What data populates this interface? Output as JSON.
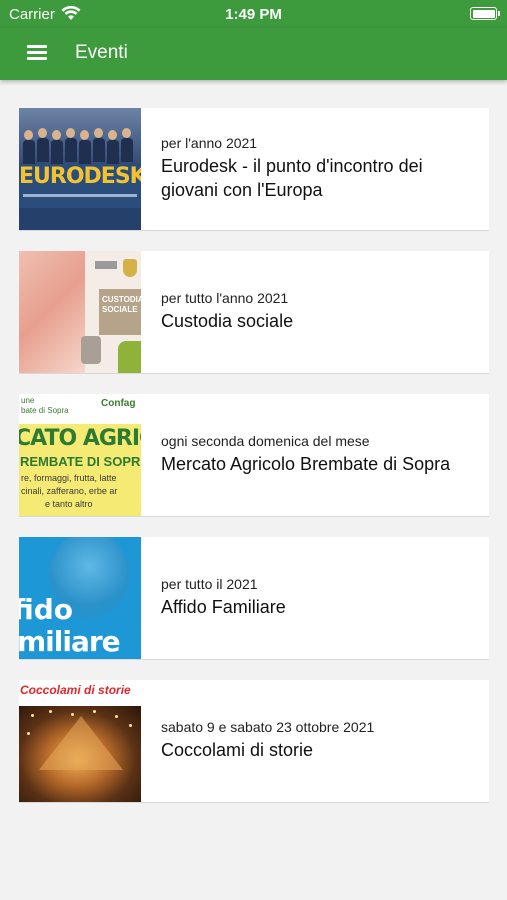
{
  "status_bar": {
    "carrier": "Carrier",
    "time": "1:49 PM"
  },
  "app_bar": {
    "title": "Eventi",
    "menu_icon": "hamburger-menu-icon"
  },
  "events": [
    {
      "date": "per l'anno 2021",
      "title": "Eurodesk - il punto d'incontro dei giovani con l'Europa",
      "image": {
        "text": "EURODESK"
      }
    },
    {
      "date": "per tutto l'anno 2021",
      "title": "Custodia sociale",
      "image": {
        "text_1": "CUSTODIA",
        "text_2": "SOCIALE"
      }
    },
    {
      "date": "ogni seconda domenica del mese",
      "title": "Mercato Agricolo Brembate di Sopra",
      "image": {
        "top_line_1": "une",
        "top_line_2": "bate di Sopra",
        "logo": "Confag",
        "line_1": "CATO AGRIC",
        "line_2": "REMBATE DI SOPR",
        "line_3": "re, formaggi, frutta, latte",
        "line_4": "cinali, zafferano, erbe ar",
        "line_5": "e tanto altro"
      }
    },
    {
      "date": "per tutto il 2021",
      "title": "Affido Familiare",
      "image": {
        "line_1": "fido",
        "line_2": "miliare"
      }
    },
    {
      "date": "sabato 9 e sabato 23 ottobre 2021",
      "title": "Coccolami di storie",
      "image": {
        "text": "Coccolami di storie"
      }
    }
  ]
}
